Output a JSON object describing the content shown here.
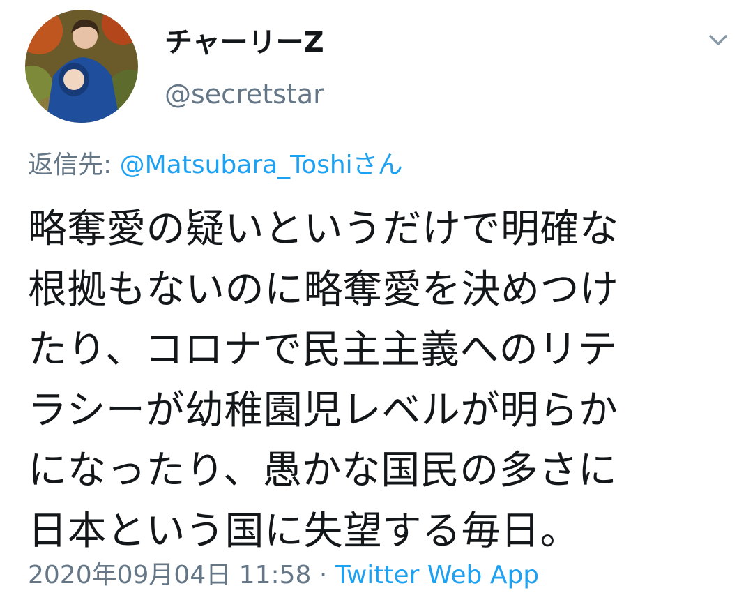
{
  "user": {
    "display_name": "チャーリーZ",
    "handle": "@secretstar",
    "avatar": "profile-photo"
  },
  "reply": {
    "prefix": "返信先:",
    "mention": "@Matsubara_Toshi",
    "suffix": "さん"
  },
  "tweet": {
    "lines": [
      "略奪愛の疑いというだけで明確な",
      "根拠もないのに略奪愛を決めつけ",
      "たり、コロナで民主主義へのリテ",
      "ラシーが幼稚園児レベルが明らか",
      "になったり、愚かな国民の多さに",
      "日本という国に失望する毎日。"
    ]
  },
  "meta": {
    "timestamp": "2020年09月04日 11:58",
    "separator": "·",
    "source": "Twitter Web App"
  },
  "icons": {
    "menu": "chevron-down-icon"
  },
  "colors": {
    "text": "#14171a",
    "secondary": "#657786",
    "link": "#1da1f2"
  }
}
